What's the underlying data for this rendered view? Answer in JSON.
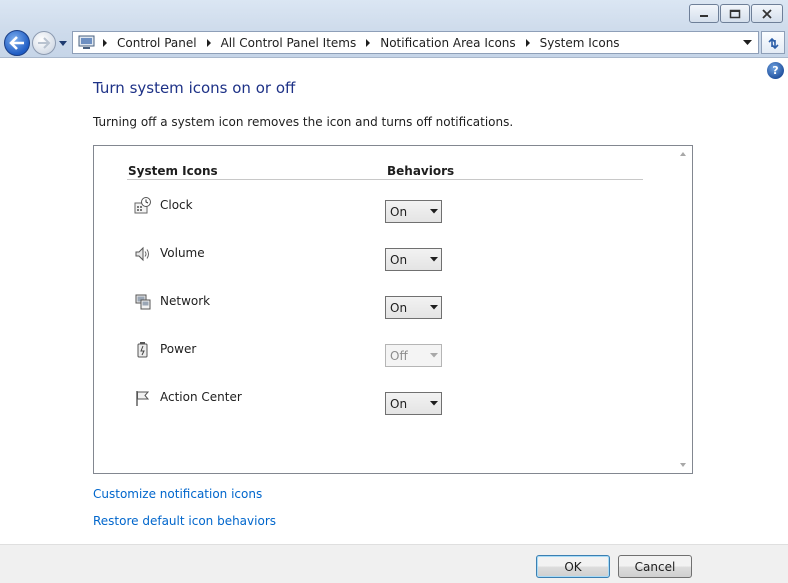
{
  "breadcrumb": [
    "Control Panel",
    "All Control Panel Items",
    "Notification Area Icons",
    "System Icons"
  ],
  "help_glyph": "?",
  "page": {
    "title": "Turn system icons on or off",
    "description": "Turning off a system icon removes the icon and turns off notifications."
  },
  "table": {
    "col_icons": "System Icons",
    "col_behaviors": "Behaviors",
    "rows": [
      {
        "label": "Clock",
        "icon": "clock-icon",
        "value": "On",
        "enabled": true
      },
      {
        "label": "Volume",
        "icon": "volume-icon",
        "value": "On",
        "enabled": true
      },
      {
        "label": "Network",
        "icon": "network-icon",
        "value": "On",
        "enabled": true
      },
      {
        "label": "Power",
        "icon": "power-icon",
        "value": "Off",
        "enabled": false
      },
      {
        "label": "Action Center",
        "icon": "action-center-flag-icon",
        "value": "On",
        "enabled": true
      }
    ]
  },
  "links": {
    "customize": "Customize notification icons",
    "restore": "Restore default icon behaviors"
  },
  "buttons": {
    "ok": "OK",
    "cancel": "Cancel"
  },
  "colors": {
    "title": "#1e3287",
    "link": "#0066cc"
  }
}
